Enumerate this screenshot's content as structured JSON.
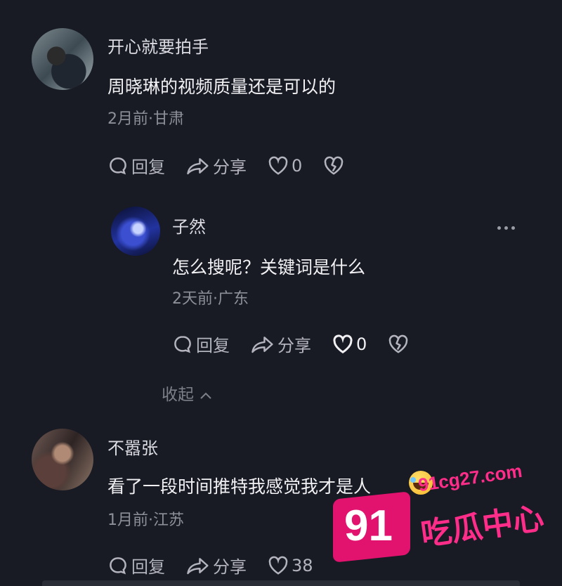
{
  "comments": [
    {
      "username": "开心就要拍手",
      "text": "周晓琳的视频质量还是可以的",
      "meta": "2月前·甘肃",
      "reply_label": "回复",
      "share_label": "分享",
      "likes": "0"
    },
    {
      "username": "子然",
      "text": "怎么搜呢？关键词是什么",
      "meta": "2天前·广东",
      "reply_label": "回复",
      "share_label": "分享",
      "likes": "0"
    },
    {
      "username": "不嚣张",
      "text": "看了一段时间推特我感觉我才是人",
      "meta": "1月前·江苏",
      "reply_label": "回复",
      "share_label": "分享",
      "likes": "38"
    }
  ],
  "collapse_label": "收起",
  "watermark": {
    "site": "91cg27.com",
    "number": "91",
    "name": "吃瓜中心"
  },
  "colors": {
    "background": "#181a24",
    "watermark": "#e2126f"
  }
}
